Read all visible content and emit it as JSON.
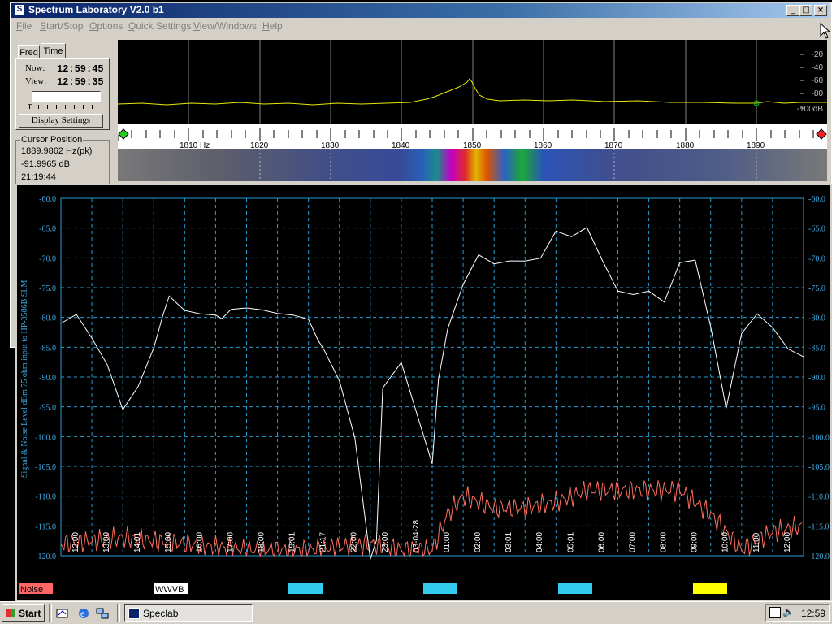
{
  "window": {
    "title": "Spectrum Laboratory V2.0 b1",
    "minimize": "_",
    "maximize": "□",
    "close": "×"
  },
  "menu": [
    "File",
    "Start/Stop",
    "Options",
    "Quick Settings",
    "View/Windows",
    "Help"
  ],
  "menu_underline": [
    "F",
    "S",
    "O",
    "Q",
    "V",
    "H"
  ],
  "tabs": {
    "freq": "Freq",
    "time": "Time"
  },
  "time_panel": {
    "now_label": "Now:",
    "now_value": "12:59:45",
    "view_label": "View:",
    "view_value": "12:59:35",
    "display_settings": "Display Settings"
  },
  "cursor": {
    "legend": "Cursor Position",
    "freq": "1889.9862 Hz(pk)",
    "level": "-91.9965 dB",
    "time": "21:19:44"
  },
  "spectrum": {
    "db_labels": [
      "-20",
      "-40",
      "-60",
      "-80",
      "-100dB"
    ],
    "freq_labels": [
      "1810 Hz",
      "1820",
      "1830",
      "1840",
      "1850",
      "1860",
      "1870",
      "1880",
      "1890"
    ],
    "trace_color": "#e8e800"
  },
  "plot": {
    "ylabel": "Signal & Noise Level dBm 75 ohm input to HP-3586B SLM",
    "y_ticks": [
      "-60.0",
      "-65.0",
      "-70.0",
      "-75.0",
      "-80.0",
      "-85.0",
      "-90.0",
      "-95.0",
      "-100.0",
      "-105.0",
      "-110.0",
      "-115.0",
      "-120.0"
    ],
    "time_labels": [
      "12:00",
      "13:00",
      "14:01",
      "15:00",
      "16:00",
      "17:00",
      "18:00",
      "19:01",
      "21:17",
      "22:00",
      "23:00",
      "03-04-28",
      "01:00",
      "02:00",
      "03:01",
      "04:00",
      "05:01",
      "06:00",
      "07:00",
      "08:00",
      "09:00",
      "10:00",
      "11:00",
      "12:00"
    ],
    "legend": [
      {
        "label": "Noise",
        "color": "#ff6666"
      },
      {
        "label": "WWVB",
        "color": "#ffffff"
      },
      {
        "label": "",
        "color": "#33ccee"
      },
      {
        "label": "",
        "color": "#33ccee"
      },
      {
        "label": "",
        "color": "#33ccee"
      },
      {
        "label": "",
        "color": "#ffff00"
      }
    ],
    "grid_color": "#2a9bd0",
    "signal_color": "#ffffff",
    "noise_color": "#ff7060"
  },
  "chart_data": [
    {
      "type": "line",
      "ylabel": "Signal & Noise Level dBm 75 ohm input to HP-3586B SLM",
      "ylim": [
        -120,
        -60
      ],
      "grid": true,
      "categories": [
        "12:00",
        "13:00",
        "14:01",
        "15:00",
        "16:00",
        "17:00",
        "18:00",
        "19:01",
        "21:17",
        "22:00",
        "23:00",
        "03-04-28",
        "01:00",
        "02:00",
        "03:01",
        "04:00",
        "05:01",
        "06:00",
        "07:00",
        "08:00",
        "09:00",
        "10:00",
        "11:00",
        "12:00"
      ],
      "series": [
        {
          "name": "WWVB",
          "x": [
            0,
            0.5,
            1,
            1.5,
            2,
            2.5,
            3,
            3.3,
            3.5,
            4,
            4.5,
            5,
            5.2,
            5.5,
            6,
            6.5,
            7,
            7.5,
            8,
            8.3,
            8.5,
            9,
            9.5,
            10,
            10.2,
            10.4,
            10.6,
            11,
            11.5,
            12,
            12.2,
            12.5,
            13,
            13.5,
            14,
            14.5,
            15,
            15.5,
            16,
            16.5,
            17,
            17.5,
            18,
            18.5,
            19,
            19.5,
            20,
            20.5,
            21,
            21.5,
            22,
            22.5,
            23,
            23.5,
            24
          ],
          "y": [
            -81,
            -80,
            -84,
            -88,
            -95,
            -91,
            -85,
            -80,
            -77,
            -79,
            -79,
            -79,
            -80,
            -79,
            -79,
            -79,
            -79,
            -79,
            -80,
            -84,
            -86,
            -91,
            -100,
            -120,
            -117,
            -92,
            -91,
            -88,
            -96,
            -104,
            -90,
            -82,
            -75,
            -70,
            -71,
            -70,
            -70,
            -70,
            -66,
            -67,
            -65,
            -70,
            -75,
            -76,
            -76,
            -78,
            -71,
            -70,
            -81,
            -95,
            -83,
            -80,
            -82,
            -85,
            -86
          ]
        }
      ]
    }
  ]
}
